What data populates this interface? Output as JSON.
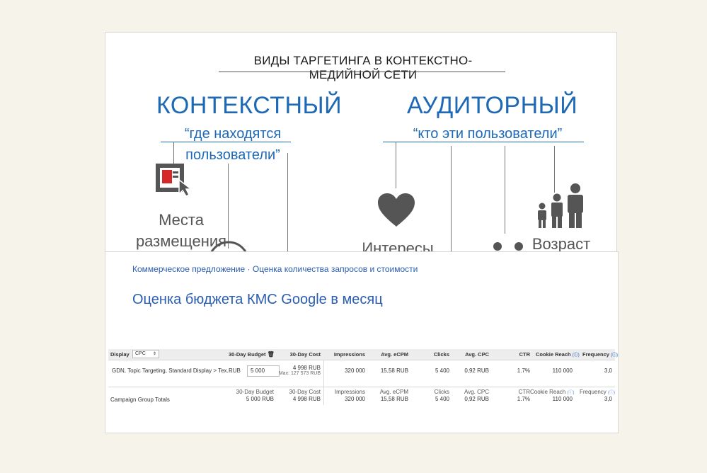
{
  "slide": {
    "title": "ВИДЫ ТАРГЕТИНГА В КОНТЕКСТНО-МЕДИЙНОЙ СЕТИ",
    "left": {
      "heading": "КОНТЕКСТНЫЙ",
      "subtitle_line1": "“где находятся",
      "subtitle_line2": "пользователи”",
      "item_line1": "Места",
      "item_line2": "размещения"
    },
    "right": {
      "heading": "АУДИТОРНЫЙ",
      "subtitle": "“кто эти пользователи”",
      "item_interests": "Интересы",
      "item_age": "Возраст"
    },
    "accent_color": "#1d69b6",
    "icon_color": "#555555",
    "placement_icon_color": "#d62828"
  },
  "panel": {
    "breadcrumb": "Коммерческое предложение · Оценка количества запросов и стоимости",
    "title": "Оценка бюджета КМС Google в месяц",
    "table": {
      "display_label": "Display",
      "display_select": "CPC",
      "headers": {
        "budget": "30-Day Budget",
        "cost": "30-Day Cost",
        "impressions": "Impressions",
        "ecpm": "Avg. eCPM",
        "clicks": "Clicks",
        "cpc": "Avg. CPC",
        "ctr": "CTR",
        "cookie_reach": "Cookie Reach",
        "frequency": "Frequency"
      },
      "row": {
        "name": "GDN, Topic Targeting, Standard Display > Tex...",
        "currency": "RUB",
        "budget": "5 000",
        "cost": "4 998 RUB",
        "cost_max": "Max: 127 573 RUB",
        "impressions": "320 000",
        "ecpm": "15,58 RUB",
        "clicks": "5 400",
        "cpc": "0,92 RUB",
        "ctr": "1.7%",
        "cookie_reach": "110 000",
        "frequency": "3,0"
      },
      "totals": {
        "label": "Campaign Group Totals",
        "headers": {
          "budget": "30-Day Budget",
          "cost": "30-Day Cost",
          "impressions": "Impressions",
          "ecpm": "Avg. eCPM",
          "clicks": "Clicks",
          "cpc": "Avg. CPC",
          "ctr": "CTR",
          "cookie_reach": "Cookie Reach",
          "frequency": "Frequency"
        },
        "budget": "5 000 RUB",
        "cost": "4 998 RUB",
        "impressions": "320 000",
        "ecpm": "15,58 RUB",
        "clicks": "5 400",
        "cpc": "0,92 RUB",
        "ctr": "1.7%",
        "cookie_reach": "110 000",
        "frequency": "3,0"
      }
    }
  }
}
